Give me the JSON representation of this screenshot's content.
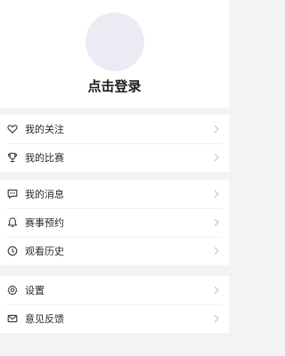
{
  "profile": {
    "login_label": "点击登录"
  },
  "groups": [
    {
      "items": [
        {
          "label": "我的关注",
          "icon": "heart-icon"
        },
        {
          "label": "我的比赛",
          "icon": "trophy-icon"
        }
      ]
    },
    {
      "items": [
        {
          "label": "我的消息",
          "icon": "message-icon"
        },
        {
          "label": "赛事预约",
          "icon": "bell-icon"
        },
        {
          "label": "观看历史",
          "icon": "clock-icon"
        }
      ]
    },
    {
      "items": [
        {
          "label": "设置",
          "icon": "gear-icon"
        },
        {
          "label": "意见反馈",
          "icon": "mail-icon"
        }
      ]
    }
  ],
  "colors": {
    "background": "#f3f3f5",
    "card": "#ffffff",
    "avatar": "#ebebf3",
    "chevron": "#c4c4c8"
  }
}
